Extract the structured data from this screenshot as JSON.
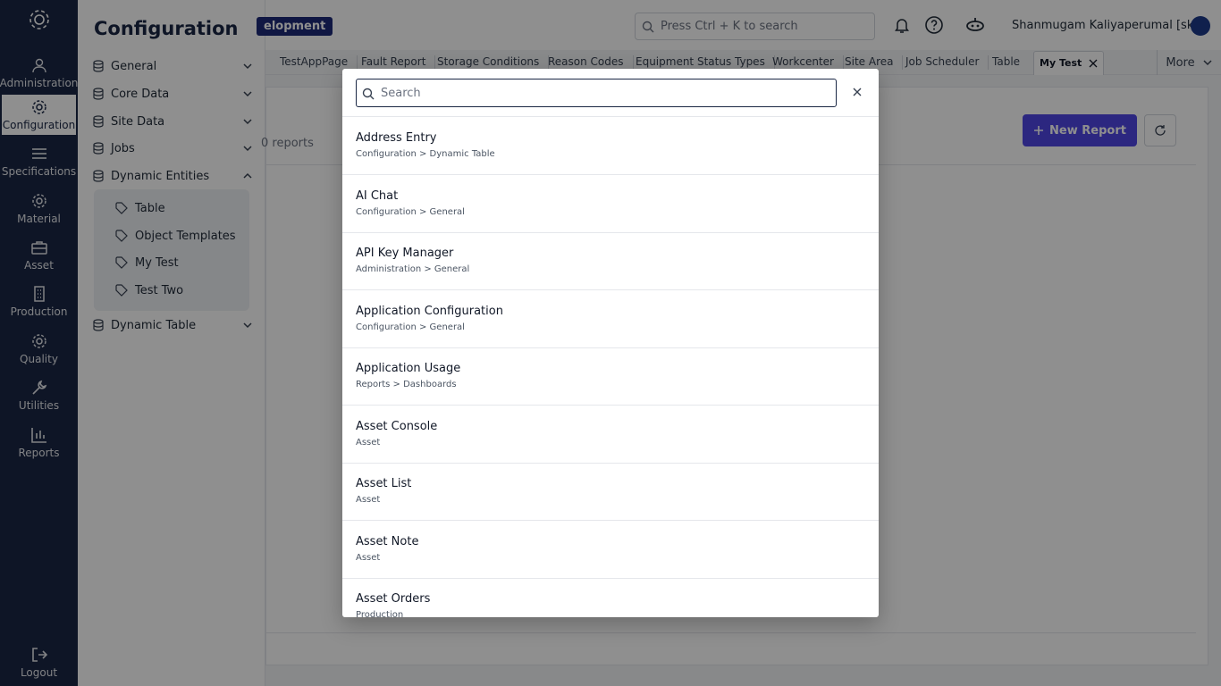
{
  "rail": {
    "items": [
      {
        "label": "Administration",
        "icon": "admin-icon"
      },
      {
        "label": "Configuration",
        "icon": "gear-icon"
      },
      {
        "label": "Specifications",
        "icon": "list-icon"
      },
      {
        "label": "Material",
        "icon": "gear-icon"
      },
      {
        "label": "Asset",
        "icon": "briefcase-icon"
      },
      {
        "label": "Production",
        "icon": "building-icon"
      },
      {
        "label": "Quality",
        "icon": "gear-icon"
      },
      {
        "label": "Utilities",
        "icon": "wrench-icon"
      },
      {
        "label": "Reports",
        "icon": "bar-chart-icon"
      }
    ],
    "logout_label": "Logout"
  },
  "sidebar": {
    "title": "Configuration",
    "items": [
      {
        "label": "General"
      },
      {
        "label": "Core Data"
      },
      {
        "label": "Site Data"
      },
      {
        "label": "Jobs"
      },
      {
        "label": "Dynamic Entities"
      },
      {
        "label": "Dynamic Table"
      }
    ],
    "subitems": [
      {
        "label": "Table"
      },
      {
        "label": "Object Templates"
      },
      {
        "label": "My Test"
      },
      {
        "label": "Test Two"
      }
    ]
  },
  "header": {
    "env_badge": "elopment",
    "search_placeholder": "Press Ctrl + K to search",
    "user_name": "Shanmugam Kaliyaperumal [sk]"
  },
  "tabs": {
    "items": [
      "TestAppPage",
      "Fault Report",
      "Storage Conditions",
      "Reason Codes",
      "Equipment Status Types",
      "Workcenter",
      "Site Area",
      "Job Scheduler",
      "Table"
    ],
    "active": "My Test",
    "more_label": "More"
  },
  "main": {
    "reports_count": "0 reports",
    "new_report_label": "New Report"
  },
  "modal": {
    "search_placeholder": "Search",
    "results": [
      {
        "title": "Address Entry",
        "path": "Configuration > Dynamic Table"
      },
      {
        "title": "AI Chat",
        "path": "Configuration > General"
      },
      {
        "title": "API Key Manager",
        "path": "Administration > General"
      },
      {
        "title": "Application Configuration",
        "path": "Configuration > General"
      },
      {
        "title": "Application Usage",
        "path": "Reports > Dashboards"
      },
      {
        "title": "Asset Console",
        "path": "Asset"
      },
      {
        "title": "Asset List",
        "path": "Asset"
      },
      {
        "title": "Asset Note",
        "path": "Asset"
      },
      {
        "title": "Asset Orders",
        "path": "Production"
      }
    ]
  },
  "colors": {
    "rail_bg": "#1a2744",
    "accent": "#4f46e5",
    "env_badge": "#1e2a78"
  }
}
